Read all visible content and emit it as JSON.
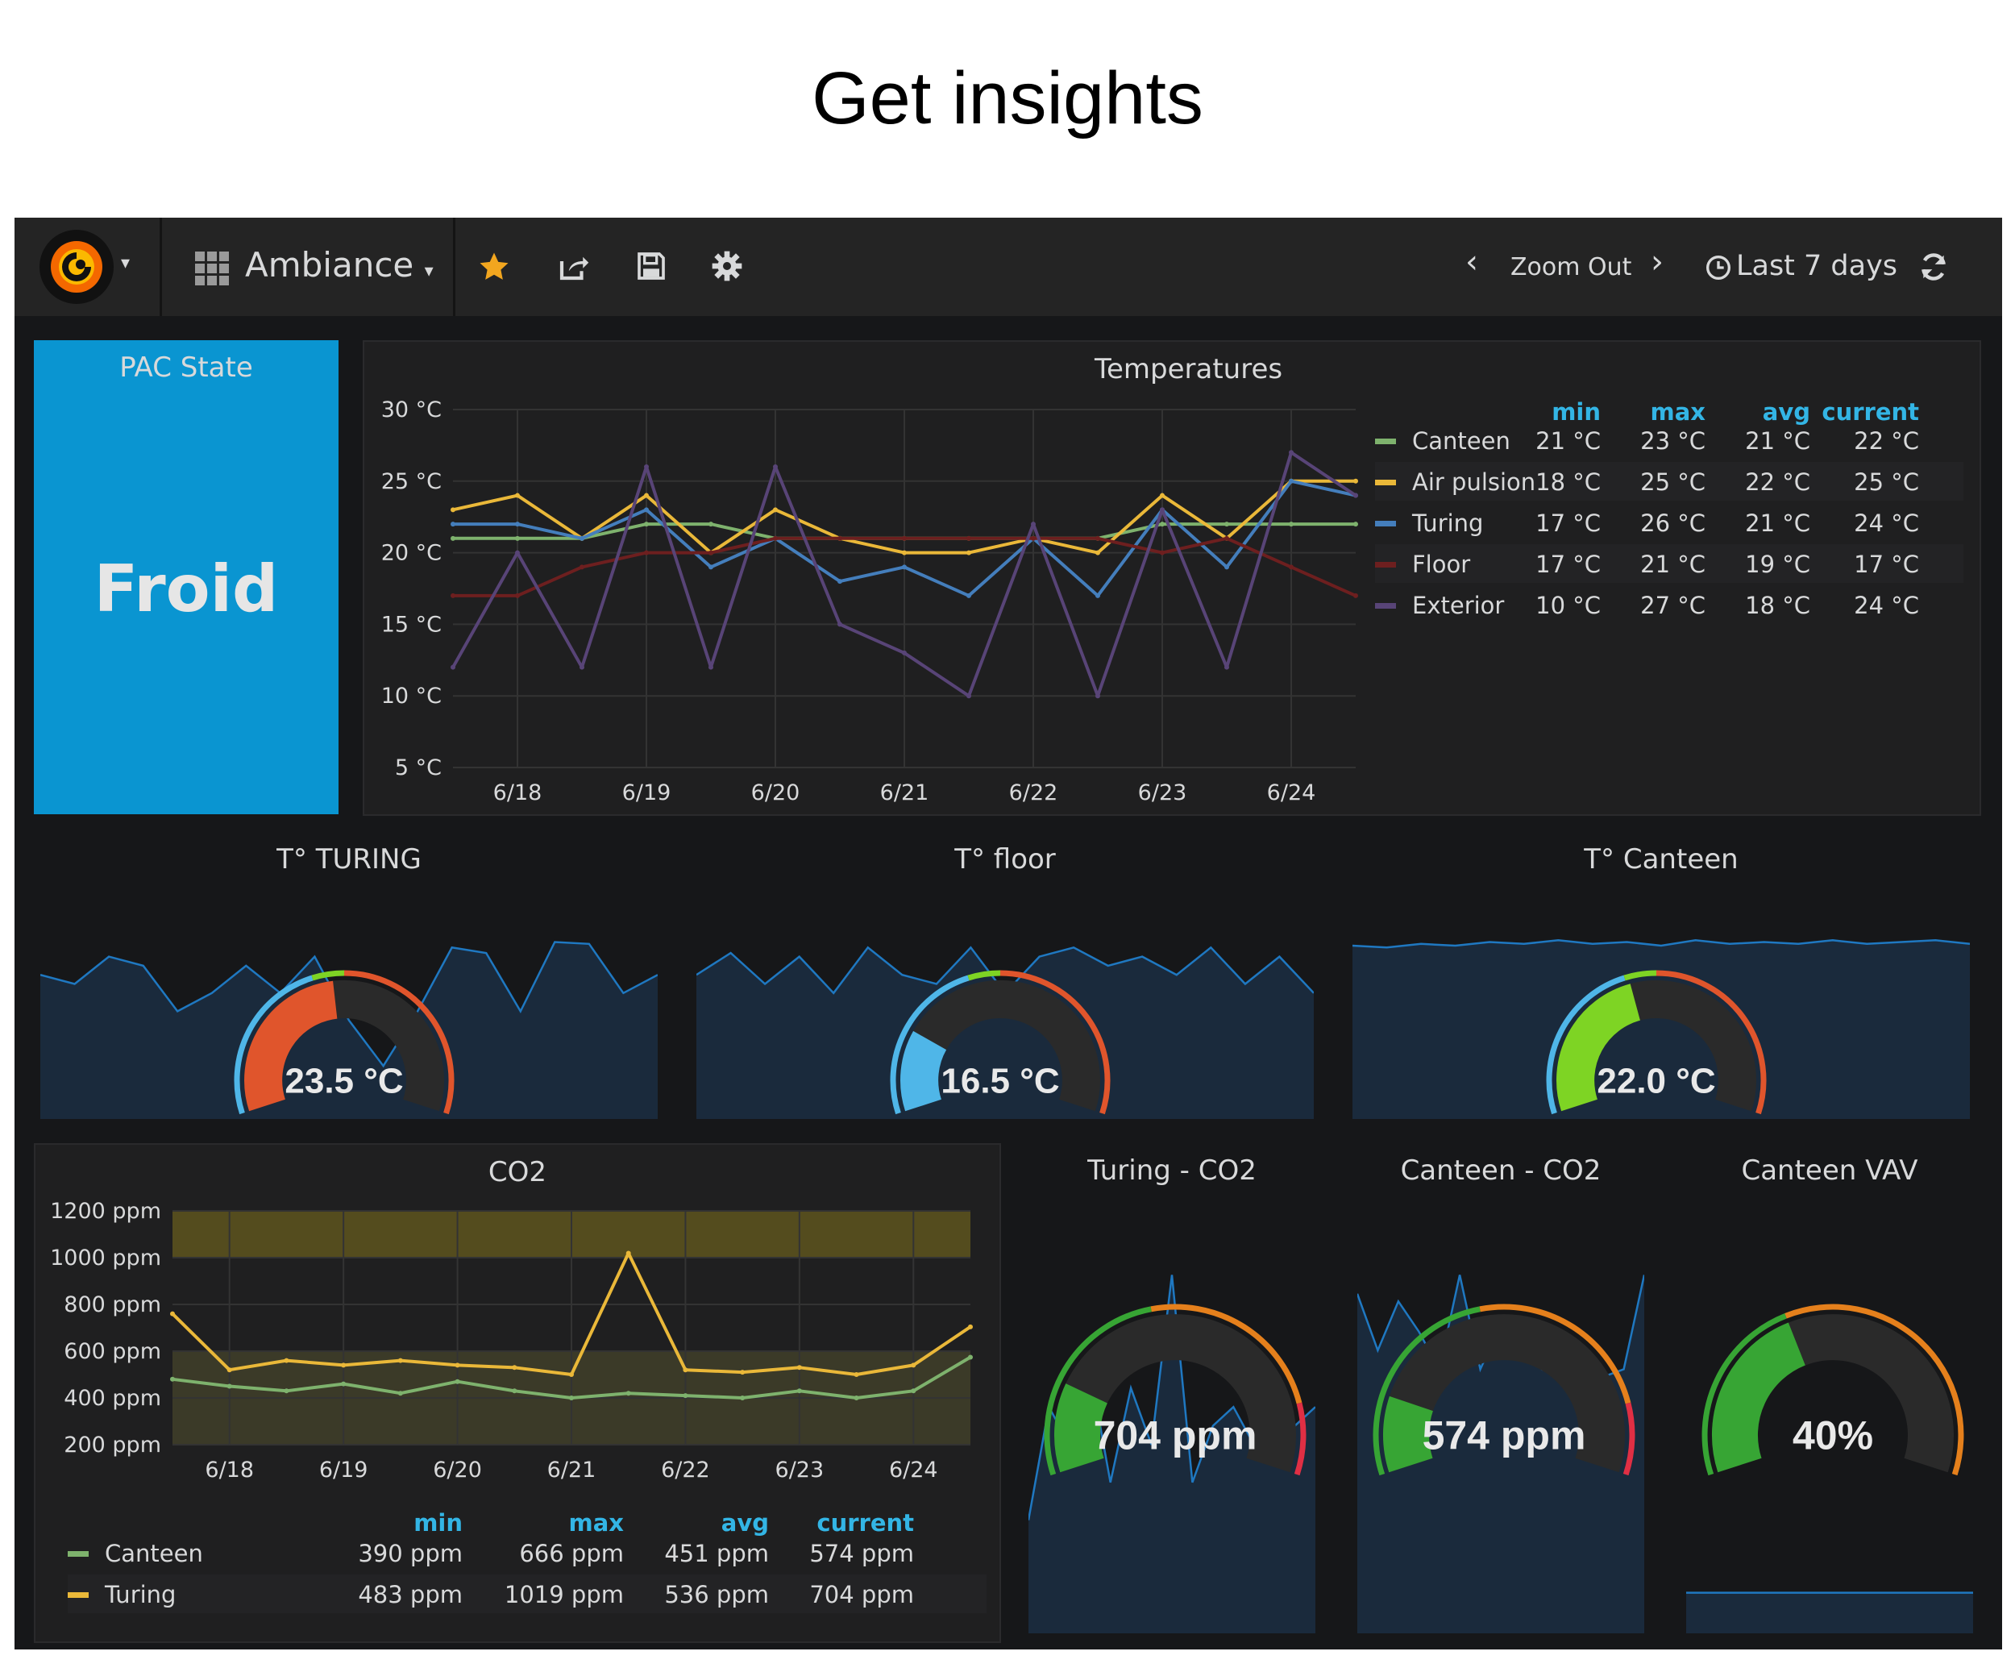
{
  "heading": "Get insights",
  "navbar": {
    "dashboard_name": "Ambiance",
    "zoom_out": "Zoom Out",
    "time_range": "Last 7 days",
    "colors": {
      "star": "#f2a61f",
      "logo_orange": "#f46800"
    }
  },
  "pac_state": {
    "title": "PAC State",
    "value": "Froid",
    "bg": "#0a95d1"
  },
  "temperatures": {
    "title": "Temperatures",
    "y_ticks": [
      "30 °C",
      "25 °C",
      "20 °C",
      "15 °C",
      "10 °C",
      "5 °C"
    ],
    "x_ticks": [
      "6/18",
      "6/19",
      "6/20",
      "6/21",
      "6/22",
      "6/23",
      "6/24"
    ],
    "legend_headers": [
      "min",
      "max",
      "avg",
      "current"
    ],
    "legend": [
      {
        "name": "Canteen",
        "color": "#7eb26d",
        "min": "21 °C",
        "max": "23 °C",
        "avg": "21 °C",
        "current": "22 °C"
      },
      {
        "name": "Air pulsion",
        "color": "#eab839",
        "min": "18 °C",
        "max": "25 °C",
        "avg": "22 °C",
        "current": "25 °C"
      },
      {
        "name": "Turing",
        "color": "#447ebc",
        "min": "17 °C",
        "max": "26 °C",
        "avg": "21 °C",
        "current": "24 °C"
      },
      {
        "name": "Floor",
        "color": "#6d1f1f",
        "min": "17 °C",
        "max": "21 °C",
        "avg": "19 °C",
        "current": "17 °C"
      },
      {
        "name": "Exterior",
        "color": "#584477",
        "min": "10 °C",
        "max": "27 °C",
        "avg": "18 °C",
        "current": "24 °C"
      }
    ]
  },
  "chart_data": [
    {
      "type": "line",
      "title": "Temperatures",
      "x": [
        "6/17 12:00",
        "6/18 00:00",
        "6/18 12:00",
        "6/19 00:00",
        "6/19 12:00",
        "6/20 00:00",
        "6/20 12:00",
        "6/21 00:00",
        "6/21 12:00",
        "6/22 00:00",
        "6/22 12:00",
        "6/23 00:00",
        "6/23 12:00",
        "6/24 00:00",
        "6/24 12:00"
      ],
      "ylim": [
        5,
        30
      ],
      "y_unit": "°C",
      "series": [
        {
          "name": "Canteen",
          "values": [
            21,
            21,
            21,
            22,
            22,
            21,
            21,
            21,
            21,
            21,
            21,
            22,
            22,
            22,
            22
          ]
        },
        {
          "name": "Air pulsion",
          "values": [
            23,
            24,
            21,
            24,
            20,
            23,
            21,
            20,
            20,
            21,
            20,
            24,
            21,
            25,
            25
          ]
        },
        {
          "name": "Turing",
          "values": [
            22,
            22,
            21,
            23,
            19,
            21,
            18,
            19,
            17,
            21,
            17,
            23,
            19,
            25,
            24
          ]
        },
        {
          "name": "Floor",
          "values": [
            17,
            17,
            19,
            20,
            20,
            21,
            21,
            21,
            21,
            21,
            21,
            20,
            21,
            19,
            17
          ]
        },
        {
          "name": "Exterior",
          "values": [
            12,
            20,
            12,
            26,
            12,
            26,
            15,
            13,
            10,
            22,
            10,
            23,
            12,
            27,
            24
          ]
        }
      ]
    },
    {
      "type": "line",
      "title": "CO2",
      "x": [
        "6/17 12:00",
        "6/18 00:00",
        "6/18 12:00",
        "6/19 00:00",
        "6/19 12:00",
        "6/20 00:00",
        "6/20 12:00",
        "6/21 00:00",
        "6/21 12:00",
        "6/22 00:00",
        "6/22 12:00",
        "6/23 00:00",
        "6/23 12:00",
        "6/24 00:00",
        "6/24 12:00"
      ],
      "ylim": [
        200,
        1200
      ],
      "y_unit": "ppm",
      "series": [
        {
          "name": "Canteen",
          "values": [
            480,
            450,
            430,
            460,
            420,
            470,
            430,
            400,
            420,
            410,
            400,
            430,
            400,
            430,
            574
          ]
        },
        {
          "name": "Turing",
          "values": [
            760,
            520,
            560,
            540,
            560,
            540,
            530,
            500,
            1019,
            520,
            510,
            530,
            500,
            540,
            704
          ]
        }
      ]
    }
  ],
  "co2": {
    "title": "CO2",
    "y_ticks": [
      "1200 ppm",
      "1000 ppm",
      "800 ppm",
      "600 ppm",
      "400 ppm",
      "200 ppm"
    ],
    "x_ticks": [
      "6/18",
      "6/19",
      "6/20",
      "6/21",
      "6/22",
      "6/23",
      "6/24"
    ],
    "legend_headers": [
      "min",
      "max",
      "avg",
      "current"
    ],
    "legend": [
      {
        "name": "Canteen",
        "color": "#7eb26d",
        "min": "390 ppm",
        "max": "666 ppm",
        "avg": "451 ppm",
        "current": "574 ppm"
      },
      {
        "name": "Turing",
        "color": "#eab839",
        "min": "483 ppm",
        "max": "1019 ppm",
        "avg": "536 ppm",
        "current": "704 ppm"
      }
    ]
  },
  "gauges_temp": [
    {
      "title": "T° TURING",
      "value": "23.5 °C",
      "fraction": 0.47,
      "color": "#e0552c"
    },
    {
      "title": "T° floor",
      "value": "16.5 °C",
      "fraction": 0.22,
      "color": "#4fb6e8"
    },
    {
      "title": "T° Canteen",
      "value": "22.0 °C",
      "fraction": 0.43,
      "color": "#7ed424"
    }
  ],
  "gauges_co2": [
    {
      "title": "Turing - CO2",
      "value": "704 ppm",
      "fraction": 0.2,
      "color": "#37a534"
    },
    {
      "title": "Canteen - CO2",
      "value": "574 ppm",
      "fraction": 0.17,
      "color": "#37a534"
    },
    {
      "title": "Canteen VAV",
      "value": "40%",
      "fraction": 0.4,
      "color": "#37a534"
    }
  ]
}
